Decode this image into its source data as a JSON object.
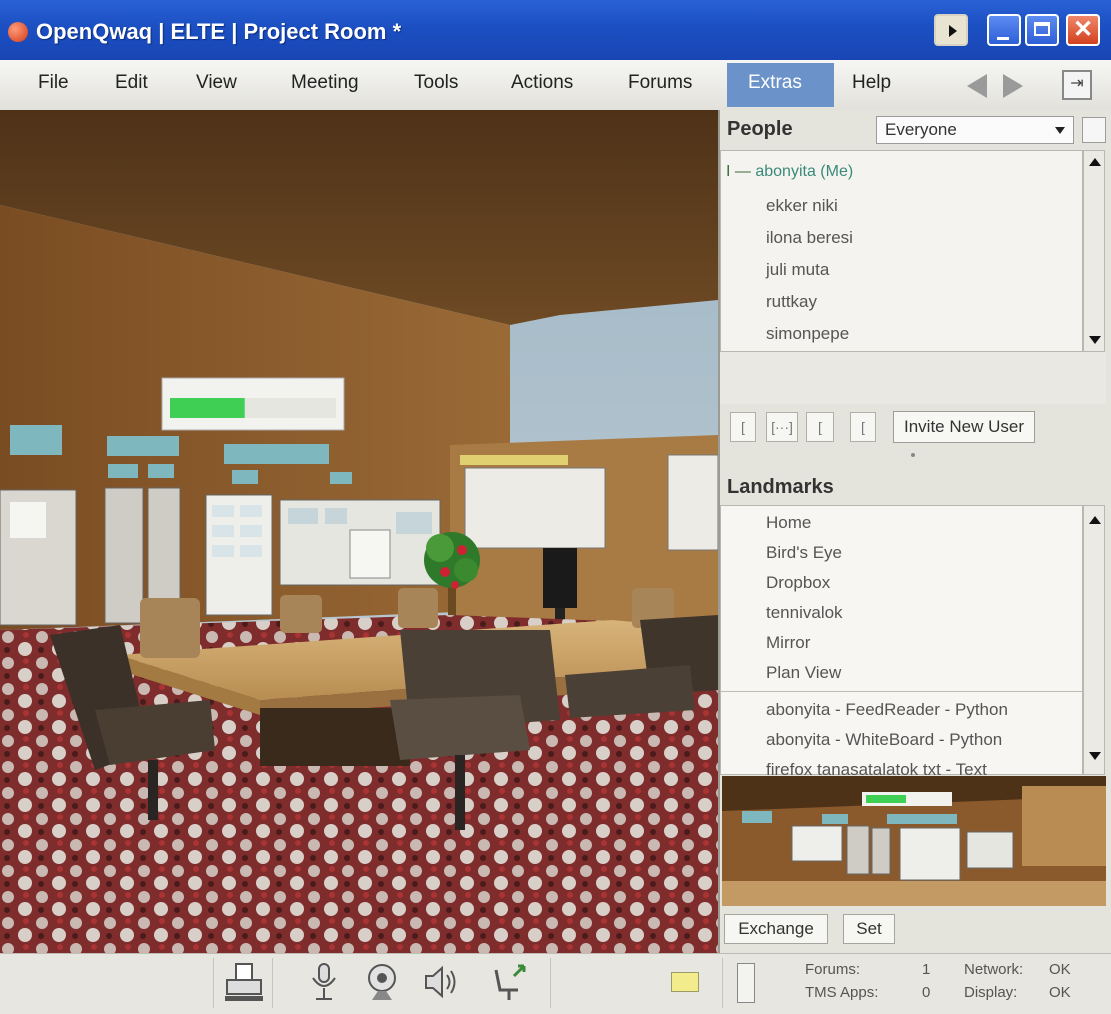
{
  "window": {
    "title": "OpenQwaq  |  ELTE  |  Project Room  *",
    "close_glyph": "✕",
    "undock_glyph": "⇥"
  },
  "menu": {
    "items": [
      "File",
      "Edit",
      "View",
      "Meeting",
      "Tools",
      "Actions",
      "Forums",
      "Extras",
      "Help"
    ],
    "active": "Extras",
    "active_color": "#6b93c9"
  },
  "people": {
    "title": "People",
    "filter_value": "Everyone",
    "self_user": "abonyita",
    "self_tag": "(Me)",
    "self_prefix": "I —",
    "users": [
      "ekker niki",
      "ilona beresi",
      "juli muta",
      "ruttkay",
      "simonpepe"
    ],
    "toolbar_glyphs": [
      "[",
      "[···]",
      "[",
      "["
    ],
    "invite_label": "Invite New User"
  },
  "landmarks": {
    "title": "Landmarks",
    "items": [
      "Home",
      "Bird's Eye",
      "Dropbox",
      "tennivalok",
      "Mirror",
      "Plan View"
    ],
    "apps": [
      "abonyita - FeedReader - Python",
      "abonyita - WhiteBoard - Python",
      "firefox tanasatalatok txt - Text"
    ],
    "exchange_label": "Exchange",
    "set_label": "Set"
  },
  "status": {
    "forums_label": "Forums:",
    "forums_value": "1",
    "tms_label": "TMS Apps:",
    "tms_value": "0",
    "network_label": "Network:",
    "network_value": "OK",
    "display_label": "Display:",
    "display_value": "OK"
  },
  "icons": {
    "statusbar": [
      "printer-icon",
      "microphone-icon",
      "webcam-icon",
      "speaker-icon",
      "chair-icon",
      "yellow-note-icon",
      "panel-indicator-icon"
    ]
  },
  "colors": {
    "titlebar": "#1b4fc2",
    "wall": "#8a5a2c",
    "carpet": "#6e1f1f",
    "progress_fill": "#3fcf55"
  },
  "scene": {
    "progress_fraction": 0.45
  }
}
